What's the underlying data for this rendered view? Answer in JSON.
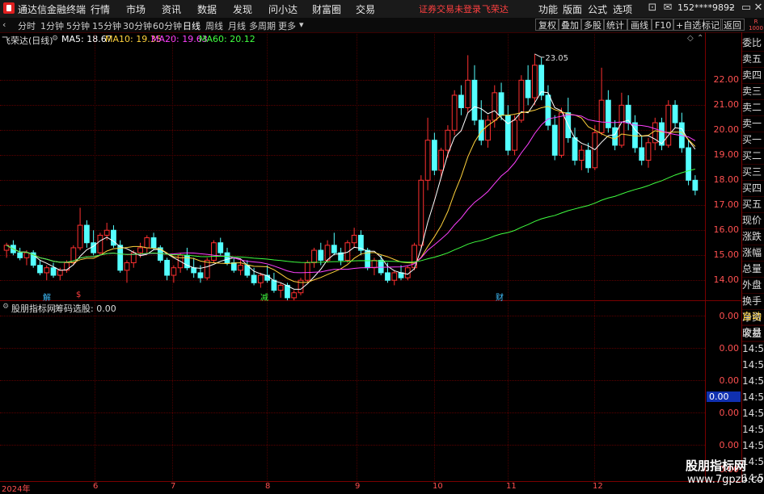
{
  "titlebar": {
    "app_name": "通达信金融终端",
    "menu": [
      "行情",
      "市场",
      "资讯",
      "数据",
      "发现",
      "问小达",
      "财富圈",
      "交易"
    ],
    "status": "证券交易未登录",
    "stock_name": "飞荣达",
    "right_menu": [
      "功能",
      "版面",
      "公式",
      "选项"
    ],
    "user": "152****9892"
  },
  "toolbar": {
    "periods": [
      "分时",
      "1分钟",
      "5分钟",
      "15分钟",
      "30分钟",
      "60分钟",
      "日线",
      "周线",
      "月线",
      "多周期",
      "更多"
    ],
    "active_period": "日线",
    "right_buttons": [
      "复权",
      "叠加",
      "多股",
      "统计",
      "画线",
      "F10",
      "+自选",
      "返回"
    ]
  },
  "chart_header": {
    "stock_label": "飞荣达(日线)",
    "ma5": "MA5: 18.67",
    "ma10": "MA10: 19.35",
    "ma20": "MA20: 19.63",
    "ma60": "MA60: 20.12",
    "colors": {
      "ma5": "#ffffff",
      "ma10": "#ffd23c",
      "ma20": "#ff40ff",
      "ma60": "#40ff40"
    }
  },
  "indicator_header": {
    "name": "股朋指标网",
    "label": "筹码选股: 0.00"
  },
  "sidebar": {
    "top_label": "R 1000",
    "items": [
      "委比",
      "卖五",
      "卖四",
      "卖三",
      "卖二",
      "卖一",
      "买一",
      "买二",
      "买三",
      "买四",
      "买五",
      "现价",
      "涨跌",
      "涨幅",
      "总量",
      "外盘",
      "换手",
      "净资",
      "收益"
    ],
    "bottom_items": [
      "自动",
      "交易"
    ],
    "times": [
      "14:56",
      "14:56",
      "14:56",
      "14:56",
      "14:56",
      "14:56",
      "14:56",
      "14:56",
      "14:56"
    ]
  },
  "indicator_axis": [
    "0.00",
    "0.00",
    "0.00",
    "0.00",
    "0.00",
    "0.00"
  ],
  "indicator_current": "0.00",
  "markers": [
    "解",
    "$",
    "减",
    "财"
  ],
  "watermark": {
    "line1": "股朋指标网",
    "line2": "www.7gpzb.com"
  },
  "chart_data": {
    "type": "candlestick",
    "price_axis": [
      "22.00",
      "21.00",
      "20.00",
      "19.00",
      "18.00",
      "17.00",
      "16.00",
      "15.00",
      "14.00"
    ],
    "ylim": [
      13.2,
      23.4
    ],
    "date_labels": [
      "2024年",
      "6",
      "7",
      "8",
      "9",
      "10",
      "11",
      "12"
    ],
    "high_annotation": "23.05",
    "low_annotation": "13.02",
    "candles": [
      [
        15.2,
        15.5,
        14.9,
        15.4
      ],
      [
        15.4,
        15.6,
        15.0,
        15.1
      ],
      [
        15.1,
        15.3,
        14.8,
        14.9
      ],
      [
        14.9,
        15.2,
        14.6,
        15.1
      ],
      [
        15.1,
        15.2,
        14.5,
        14.6
      ],
      [
        14.6,
        14.8,
        14.2,
        14.3
      ],
      [
        14.3,
        14.6,
        14.0,
        14.5
      ],
      [
        14.5,
        14.7,
        14.1,
        14.2
      ],
      [
        14.2,
        14.5,
        14.0,
        14.4
      ],
      [
        14.4,
        14.8,
        14.3,
        14.7
      ],
      [
        14.7,
        15.4,
        14.6,
        15.3
      ],
      [
        15.3,
        16.9,
        15.2,
        16.2
      ],
      [
        16.2,
        16.4,
        15.3,
        15.5
      ],
      [
        15.5,
        16.0,
        15.0,
        15.1
      ],
      [
        15.1,
        15.9,
        15.0,
        15.8
      ],
      [
        15.8,
        16.3,
        15.6,
        16.0
      ],
      [
        16.0,
        16.2,
        15.3,
        15.4
      ],
      [
        15.4,
        15.6,
        14.3,
        14.4
      ],
      [
        14.4,
        14.8,
        13.9,
        14.7
      ],
      [
        14.7,
        15.2,
        14.5,
        15.1
      ],
      [
        15.1,
        15.5,
        14.9,
        15.3
      ],
      [
        15.3,
        15.8,
        15.1,
        15.7
      ],
      [
        15.7,
        15.9,
        15.2,
        15.3
      ],
      [
        15.3,
        15.4,
        14.7,
        14.8
      ],
      [
        14.8,
        14.9,
        14.0,
        14.2
      ],
      [
        14.2,
        14.6,
        13.9,
        14.5
      ],
      [
        14.5,
        15.1,
        14.3,
        15.0
      ],
      [
        15.0,
        15.3,
        14.4,
        14.5
      ],
      [
        14.5,
        14.9,
        14.1,
        14.3
      ],
      [
        14.3,
        14.6,
        13.9,
        14.1
      ],
      [
        14.1,
        14.9,
        14.0,
        14.8
      ],
      [
        14.8,
        15.6,
        14.7,
        15.5
      ],
      [
        15.5,
        15.7,
        15.0,
        15.1
      ],
      [
        15.1,
        15.3,
        14.6,
        14.7
      ],
      [
        14.7,
        14.9,
        14.3,
        14.4
      ],
      [
        14.4,
        14.8,
        14.2,
        14.6
      ],
      [
        14.6,
        14.8,
        14.1,
        14.2
      ],
      [
        14.2,
        14.5,
        13.8,
        13.9
      ],
      [
        13.9,
        14.3,
        13.7,
        14.2
      ],
      [
        14.2,
        14.6,
        13.9,
        14.0
      ],
      [
        14.0,
        14.3,
        13.5,
        13.6
      ],
      [
        13.6,
        13.9,
        13.3,
        13.8
      ],
      [
        13.8,
        13.9,
        13.2,
        13.3
      ],
      [
        13.3,
        13.6,
        13.02,
        13.5
      ],
      [
        13.5,
        14.1,
        13.4,
        14.0
      ],
      [
        14.0,
        14.8,
        13.9,
        14.7
      ],
      [
        14.7,
        15.3,
        14.5,
        15.2
      ],
      [
        15.2,
        15.5,
        14.6,
        14.8
      ],
      [
        14.8,
        15.6,
        14.7,
        15.4
      ],
      [
        15.4,
        15.9,
        15.0,
        15.1
      ],
      [
        15.1,
        15.3,
        14.6,
        14.8
      ],
      [
        14.8,
        15.6,
        14.7,
        15.5
      ],
      [
        15.5,
        16.1,
        15.3,
        15.8
      ],
      [
        15.8,
        16.0,
        15.0,
        15.2
      ],
      [
        15.2,
        15.3,
        14.4,
        14.5
      ],
      [
        14.5,
        14.9,
        14.2,
        14.8
      ],
      [
        14.8,
        15.0,
        14.2,
        14.3
      ],
      [
        14.3,
        14.7,
        13.9,
        14.0
      ],
      [
        14.0,
        14.4,
        13.8,
        14.3
      ],
      [
        14.3,
        14.6,
        14.0,
        14.1
      ],
      [
        14.1,
        14.6,
        14.0,
        14.5
      ],
      [
        14.5,
        15.5,
        14.4,
        15.4
      ],
      [
        15.4,
        18.2,
        15.3,
        18.0
      ],
      [
        18.0,
        20.5,
        17.6,
        19.6
      ],
      [
        19.6,
        19.9,
        18.2,
        18.4
      ],
      [
        18.4,
        19.3,
        18.1,
        19.2
      ],
      [
        19.2,
        20.2,
        18.9,
        20.0
      ],
      [
        20.0,
        21.6,
        19.8,
        21.4
      ],
      [
        21.4,
        21.8,
        20.6,
        20.9
      ],
      [
        20.9,
        23.0,
        20.7,
        22.0
      ],
      [
        22.0,
        22.6,
        20.2,
        20.4
      ],
      [
        20.4,
        21.2,
        19.4,
        19.6
      ],
      [
        19.6,
        20.6,
        19.3,
        20.4
      ],
      [
        20.4,
        21.8,
        20.1,
        21.5
      ],
      [
        21.5,
        21.9,
        20.4,
        20.6
      ],
      [
        20.6,
        21.0,
        19.0,
        19.2
      ],
      [
        19.2,
        20.6,
        19.0,
        20.4
      ],
      [
        20.4,
        22.2,
        20.3,
        22.0
      ],
      [
        22.0,
        22.6,
        21.0,
        21.3
      ],
      [
        21.3,
        23.05,
        21.0,
        22.6
      ],
      [
        22.6,
        22.9,
        21.2,
        21.4
      ],
      [
        21.4,
        21.8,
        20.0,
        20.2
      ],
      [
        20.2,
        20.6,
        18.8,
        19.0
      ],
      [
        19.0,
        20.9,
        18.9,
        20.7
      ],
      [
        20.7,
        21.3,
        19.5,
        19.7
      ],
      [
        19.7,
        20.1,
        18.6,
        18.8
      ],
      [
        18.8,
        19.4,
        18.4,
        19.2
      ],
      [
        19.2,
        19.5,
        18.3,
        18.5
      ],
      [
        18.5,
        20.2,
        18.4,
        19.9
      ],
      [
        19.9,
        22.5,
        19.8,
        21.2
      ],
      [
        21.2,
        21.6,
        19.9,
        20.1
      ],
      [
        20.1,
        20.4,
        19.2,
        19.4
      ],
      [
        19.4,
        21.5,
        19.3,
        21.0
      ],
      [
        21.0,
        21.4,
        20.0,
        20.3
      ],
      [
        20.3,
        20.6,
        19.1,
        19.3
      ],
      [
        19.3,
        19.8,
        18.6,
        18.8
      ],
      [
        18.8,
        19.7,
        18.5,
        19.5
      ],
      [
        19.5,
        20.5,
        19.2,
        20.3
      ],
      [
        20.3,
        20.5,
        19.2,
        19.4
      ],
      [
        19.4,
        21.2,
        19.3,
        21.0
      ],
      [
        21.0,
        21.2,
        20.1,
        20.3
      ],
      [
        20.3,
        20.7,
        19.1,
        19.3
      ],
      [
        19.3,
        19.6,
        17.8,
        18.0
      ],
      [
        18.0,
        18.2,
        17.4,
        17.6
      ]
    ]
  }
}
